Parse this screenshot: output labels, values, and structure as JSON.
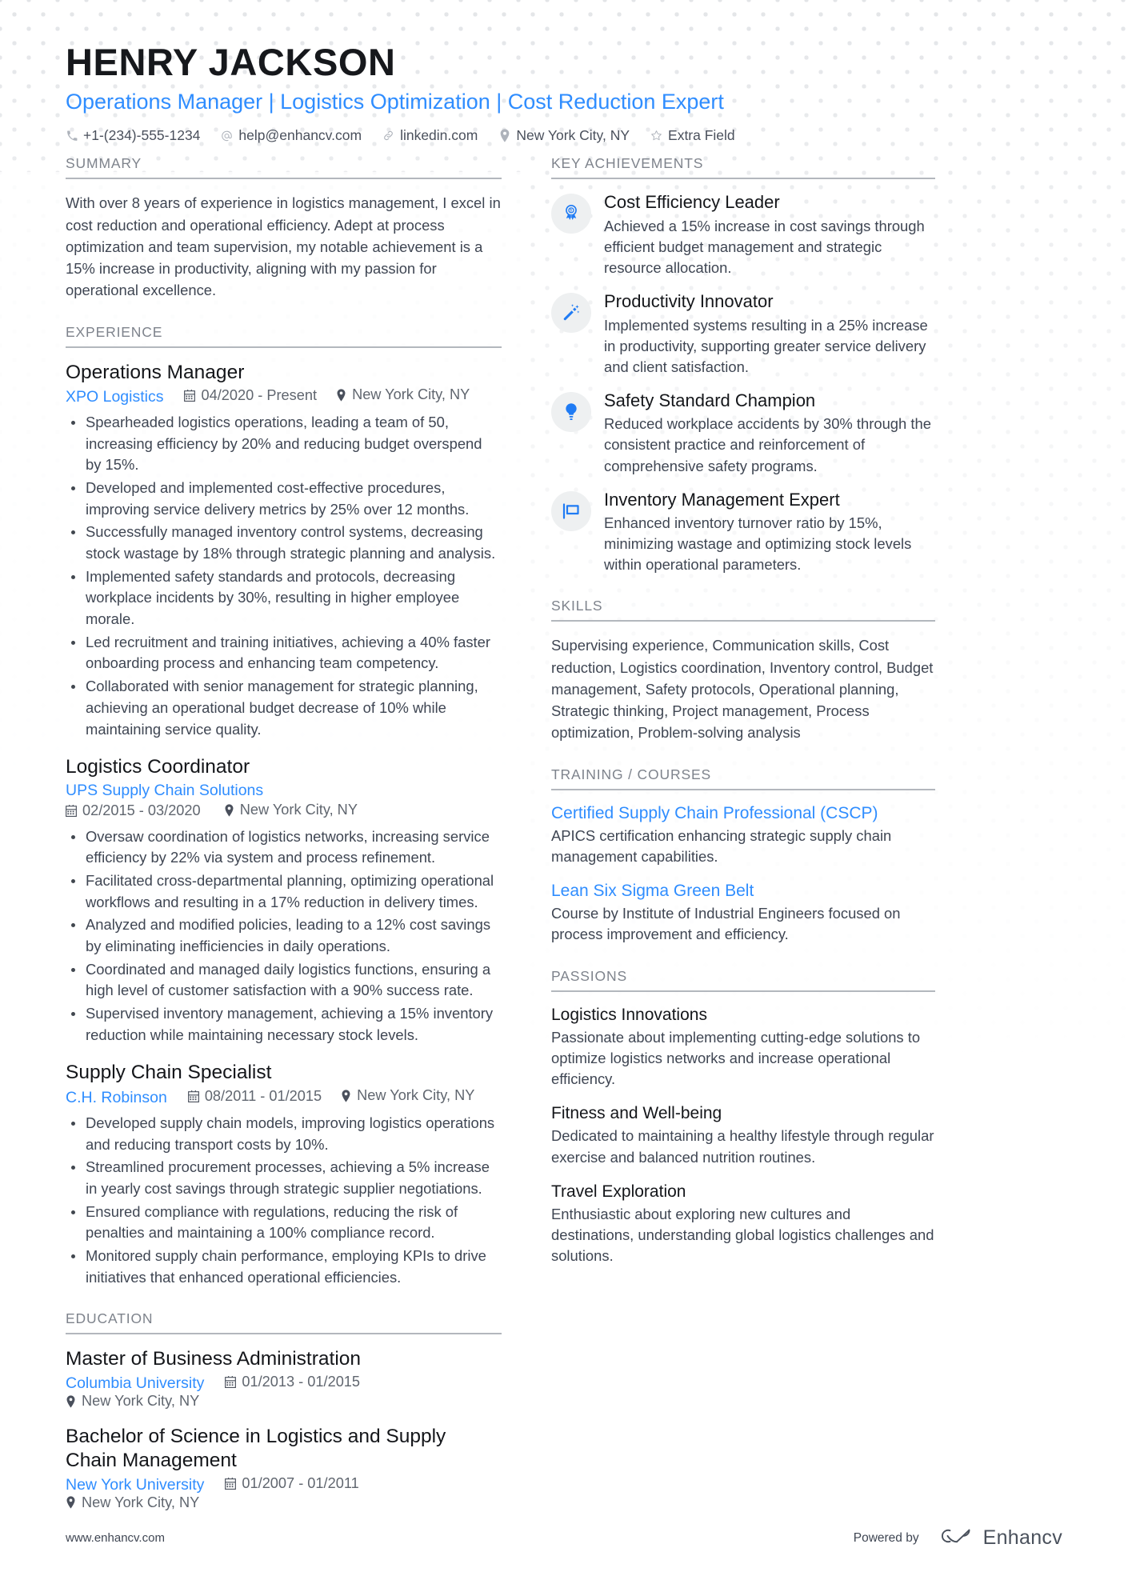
{
  "header": {
    "name": "HENRY JACKSON",
    "headline": "Operations Manager | Logistics Optimization | Cost Reduction Expert",
    "contacts": [
      {
        "icon": "phone-icon",
        "text": "+1-(234)-555-1234"
      },
      {
        "icon": "at-email-icon",
        "text": "help@enhancv.com"
      },
      {
        "icon": "link-icon",
        "text": "linkedin.com"
      },
      {
        "icon": "location-pin-icon",
        "text": "New York City, NY"
      },
      {
        "icon": "star-icon",
        "text": "Extra Field"
      }
    ]
  },
  "sections": {
    "summary_title": "SUMMARY",
    "experience_title": "EXPERIENCE",
    "education_title": "EDUCATION",
    "key_achievements_title": "KEY ACHIEVEMENTS",
    "skills_title": "SKILLS",
    "training_title": "TRAINING / COURSES",
    "passions_title": "PASSIONS"
  },
  "summary": {
    "text": "With over 8 years of experience in logistics management, I excel in cost reduction and operational efficiency. Adept at process optimization and team supervision, my notable achievement is a 15% increase in productivity, aligning with my passion for operational excellence."
  },
  "experience": [
    {
      "title": "Operations Manager",
      "org": "XPO Logistics",
      "dates": "04/2020 - Present",
      "location": "New York City, NY",
      "stacked": false,
      "bullets": [
        "Spearheaded logistics operations, leading a team of 50, increasing efficiency by 20% and reducing budget overspend by 15%.",
        "Developed and implemented cost-effective procedures, improving service delivery metrics by 25% over 12 months.",
        "Successfully managed inventory control systems, decreasing stock wastage by 18% through strategic planning and analysis.",
        "Implemented safety standards and protocols, decreasing workplace incidents by 30%, resulting in higher employee morale.",
        "Led recruitment and training initiatives, achieving a 40% faster onboarding process and enhancing team competency.",
        "Collaborated with senior management for strategic planning, achieving an operational budget decrease of 10% while maintaining service quality."
      ]
    },
    {
      "title": "Logistics Coordinator",
      "org": "UPS Supply Chain Solutions",
      "dates": "02/2015 - 03/2020",
      "location": "New York City, NY",
      "stacked": true,
      "bullets": [
        "Oversaw coordination of logistics networks, increasing service efficiency by 22% via system and process refinement.",
        "Facilitated cross-departmental planning, optimizing operational workflows and resulting in a 17% reduction in delivery times.",
        "Analyzed and modified policies, leading to a 12% cost savings by eliminating inefficiencies in daily operations.",
        "Coordinated and managed daily logistics functions, ensuring a high level of customer satisfaction with a 90% success rate.",
        "Supervised inventory management, achieving a 15% inventory reduction while maintaining necessary stock levels."
      ]
    },
    {
      "title": "Supply Chain Specialist",
      "org": "C.H. Robinson",
      "dates": "08/2011 - 01/2015",
      "location": "New York City, NY",
      "stacked": false,
      "bullets": [
        "Developed supply chain models, improving logistics operations and reducing transport costs by 10%.",
        "Streamlined procurement processes, achieving a 5% increase in yearly cost savings through strategic supplier negotiations.",
        "Ensured compliance with regulations, reducing the risk of penalties and maintaining a 100% compliance record.",
        "Monitored supply chain performance, employing KPIs to drive initiatives that enhanced operational efficiencies."
      ]
    }
  ],
  "education": [
    {
      "title": "Master of Business Administration",
      "org": "Columbia University",
      "dates": "01/2013 - 01/2015",
      "location": "New York City, NY"
    },
    {
      "title": "Bachelor of Science in Logistics and Supply Chain Management",
      "org": "New York University",
      "dates": "01/2007 - 01/2011",
      "location": "New York City, NY"
    }
  ],
  "key_achievements": [
    {
      "icon": "award-medal-icon",
      "title": "Cost Efficiency Leader",
      "desc": "Achieved a 15% increase in cost savings through efficient budget management and strategic resource allocation."
    },
    {
      "icon": "magic-wand-icon",
      "title": "Productivity Innovator",
      "desc": "Implemented systems resulting in a 25% increase in productivity, supporting greater service delivery and client satisfaction."
    },
    {
      "icon": "lightbulb-icon",
      "title": "Safety Standard Champion",
      "desc": "Reduced workplace accidents by 30% through the consistent practice and reinforcement of comprehensive safety programs."
    },
    {
      "icon": "flag-icon",
      "title": "Inventory Management Expert",
      "desc": "Enhanced inventory turnover ratio by 15%, minimizing wastage and optimizing stock levels within operational parameters."
    }
  ],
  "skills": {
    "text": "Supervising experience, Communication skills, Cost reduction, Logistics coordination, Inventory control, Budget management, Safety protocols, Operational planning, Strategic thinking, Project management, Process optimization, Problem-solving analysis"
  },
  "training": [
    {
      "title": "Certified Supply Chain Professional (CSCP)",
      "desc": "APICS certification enhancing strategic supply chain management capabilities."
    },
    {
      "title": "Lean Six Sigma Green Belt",
      "desc": "Course by Institute of Industrial Engineers focused on process improvement and efficiency."
    }
  ],
  "passions": [
    {
      "title": "Logistics Innovations",
      "desc": "Passionate about implementing cutting-edge solutions to optimize logistics networks and increase operational efficiency."
    },
    {
      "title": "Fitness and Well-being",
      "desc": "Dedicated to maintaining a healthy lifestyle through regular exercise and balanced nutrition routines."
    },
    {
      "title": "Travel Exploration",
      "desc": "Enthusiastic about exploring new cultures and destinations, understanding global logistics challenges and solutions."
    }
  ],
  "footer": {
    "url": "www.enhancv.com",
    "powered_by": "Powered by",
    "brand": "Enhancv"
  },
  "colors": {
    "accent_blue": "#2f8dff",
    "text_dark": "#14161a",
    "text_body": "#3f4653",
    "muted": "#7e838c",
    "badge_bg": "#eef0f1"
  }
}
